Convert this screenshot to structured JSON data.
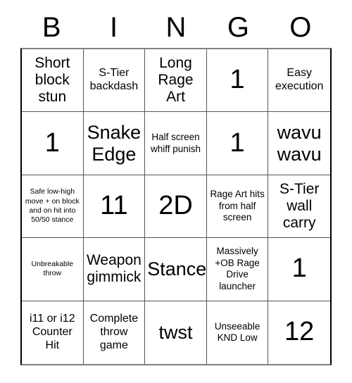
{
  "card": {
    "title": "BINGO",
    "header_letters": [
      "B",
      "I",
      "N",
      "G",
      "O"
    ],
    "rows": [
      [
        {
          "text": "Short block stun",
          "size": "md"
        },
        {
          "text": "S-Tier backdash",
          "size": "sm"
        },
        {
          "text": "Long Rage Art",
          "size": "md"
        },
        {
          "text": "1",
          "size": "xl"
        },
        {
          "text": "Easy execution",
          "size": "sm"
        }
      ],
      [
        {
          "text": "1",
          "size": "xl"
        },
        {
          "text": "Snake Edge",
          "size": "lg"
        },
        {
          "text": "Half screen whiff punish",
          "size": "xs"
        },
        {
          "text": "1",
          "size": "xl"
        },
        {
          "text": "wavu wavu",
          "size": "lg"
        }
      ],
      [
        {
          "text": "Safe low-high move + on block and on hit into 50/50 stance",
          "size": "xxs"
        },
        {
          "text": "11",
          "size": "xl"
        },
        {
          "text": "2D",
          "size": "xl"
        },
        {
          "text": "Rage Art hits from half screen",
          "size": "xs"
        },
        {
          "text": "S-Tier wall carry",
          "size": "md"
        }
      ],
      [
        {
          "text": "Unbreakable throw",
          "size": "xxs"
        },
        {
          "text": "Weapon gimmick",
          "size": "md"
        },
        {
          "text": "Stance",
          "size": "lg"
        },
        {
          "text": "Massively +OB Rage Drive launcher",
          "size": "xs"
        },
        {
          "text": "1",
          "size": "xl"
        }
      ],
      [
        {
          "text": "i11 or i12 Counter Hit",
          "size": "sm"
        },
        {
          "text": "Complete throw game",
          "size": "sm"
        },
        {
          "text": "twst",
          "size": "lg"
        },
        {
          "text": "Unseeable KND Low",
          "size": "xs"
        },
        {
          "text": "12",
          "size": "xl"
        }
      ]
    ]
  }
}
